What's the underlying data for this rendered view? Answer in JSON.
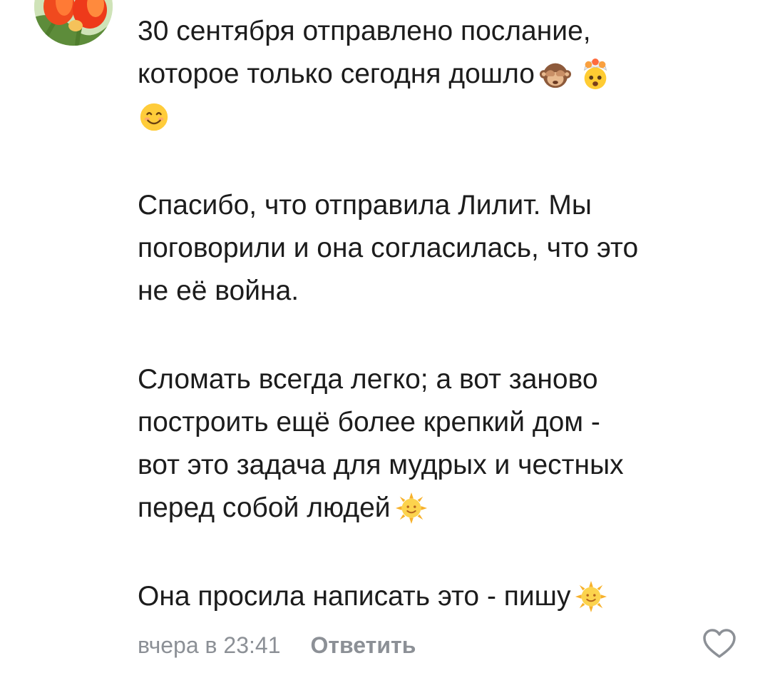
{
  "comment": {
    "avatar_icon": "tulips-avatar-icon",
    "paragraphs": [
      {
        "lines": [
          {
            "text": "30 сентября отправлено послание,",
            "emojis": []
          },
          {
            "text": "которое только сегодня дошло",
            "emojis": [
              "see-no-evil-monkey-icon",
              "exploding-head-icon"
            ]
          },
          {
            "text": "",
            "emojis": [
              "smiling-face-icon"
            ]
          }
        ]
      },
      {
        "lines": [
          {
            "text": "Спасибо, что отправила Лилит. Мы",
            "emojis": []
          },
          {
            "text": "поговорили и она согласилась, что это",
            "emojis": []
          },
          {
            "text": "не её война.",
            "emojis": []
          }
        ]
      },
      {
        "lines": [
          {
            "text": "Сломать всегда легко; а вот заново",
            "emojis": []
          },
          {
            "text": "построить ещё более крепкий дом -",
            "emojis": []
          },
          {
            "text": "вот это задача для мудрых и честных",
            "emojis": []
          },
          {
            "text": "перед собой людей",
            "emojis": [
              "sun-with-face-icon"
            ]
          }
        ]
      },
      {
        "lines": [
          {
            "text": "Она просила написать это - пишу",
            "emojis": [
              "sun-with-face-icon"
            ]
          }
        ]
      }
    ],
    "timestamp": "вчера в 23:41",
    "reply_label": "Ответить",
    "like_icon": "heart-outline-icon"
  },
  "colors": {
    "text": "#1c1c1c",
    "meta": "#8c9096",
    "background": "#ffffff"
  }
}
